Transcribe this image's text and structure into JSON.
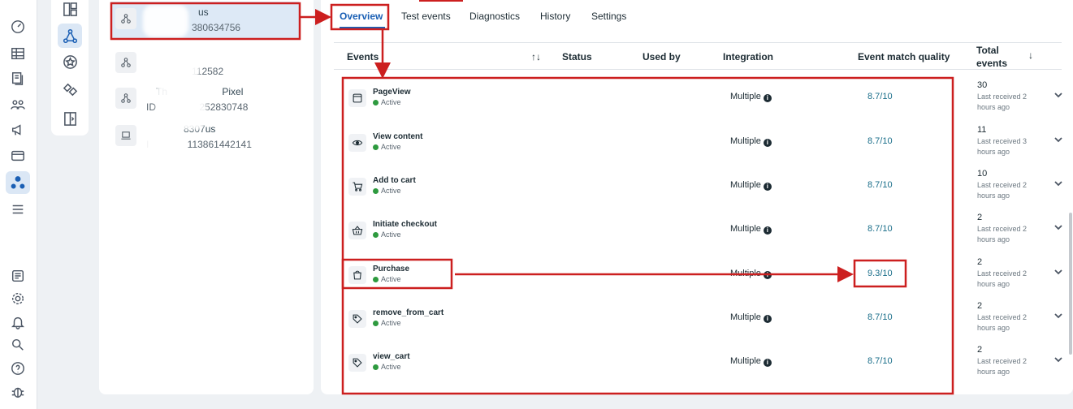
{
  "rail": {
    "icons": [
      "dashboard-icon",
      "table-icon",
      "pages-icon",
      "people-icon",
      "megaphone-icon",
      "billing-icon",
      "events-manager-icon",
      "menu-icon",
      "news-icon",
      "settings-icon",
      "notifications-icon",
      "search-icon",
      "help-icon",
      "bug-icon"
    ]
  },
  "catcol": {
    "icons": [
      "layout-icon",
      "data-sources-icon",
      "custom-conversions-icon",
      "partner-integrations-icon",
      "settings-panel-icon"
    ]
  },
  "datasets": [
    {
      "name": "us",
      "id": "380634756",
      "selected": true
    },
    {
      "name": "",
      "id": "112582",
      "selected": false
    },
    {
      "name": "Pixel",
      "id": "252830748",
      "selected": false
    },
    {
      "name": "8307us",
      "id": "113861442141",
      "selected": false
    }
  ],
  "tabs": [
    "Overview",
    "Test events",
    "Diagnostics",
    "History",
    "Settings"
  ],
  "table": {
    "headers": {
      "events": "Events",
      "sort_icon": "↑↓",
      "status": "Status",
      "used_by": "Used by",
      "integration": "Integration",
      "emq": "Event match quality",
      "total": "Total events",
      "total_sort": "↓"
    },
    "rows": [
      {
        "name": "PageView",
        "status": "Active",
        "integration": "Multiple",
        "emq": "8.7/10",
        "total": "30",
        "received": "Last received 2 hours ago",
        "icon": "browser-icon"
      },
      {
        "name": "View content",
        "status": "Active",
        "integration": "Multiple",
        "emq": "8.7/10",
        "total": "11",
        "received": "Last received 3 hours ago",
        "icon": "eye-icon"
      },
      {
        "name": "Add to cart",
        "status": "Active",
        "integration": "Multiple",
        "emq": "8.7/10",
        "total": "10",
        "received": "Last received 2 hours ago",
        "icon": "cart-icon"
      },
      {
        "name": "Initiate checkout",
        "status": "Active",
        "integration": "Multiple",
        "emq": "8.7/10",
        "total": "2",
        "received": "Last received 2 hours ago",
        "icon": "basket-icon"
      },
      {
        "name": "Purchase",
        "status": "Active",
        "integration": "Multiple",
        "emq": "9.3/10",
        "total": "2",
        "received": "Last received 2 hours ago",
        "icon": "shopping-bag-icon"
      },
      {
        "name": "remove_from_cart",
        "status": "Active",
        "integration": "Multiple",
        "emq": "8.7/10",
        "total": "2",
        "received": "Last received 2 hours ago",
        "icon": "tag-icon"
      },
      {
        "name": "view_cart",
        "status": "Active",
        "integration": "Multiple",
        "emq": "8.7/10",
        "total": "2",
        "received": "Last received 2 hours ago",
        "icon": "tag-icon"
      }
    ]
  },
  "colors": {
    "accent": "#1a5fb4",
    "annotation": "#cc1f1f",
    "active_dot": "#2e9a3f",
    "emq": "#1a6e8a"
  }
}
